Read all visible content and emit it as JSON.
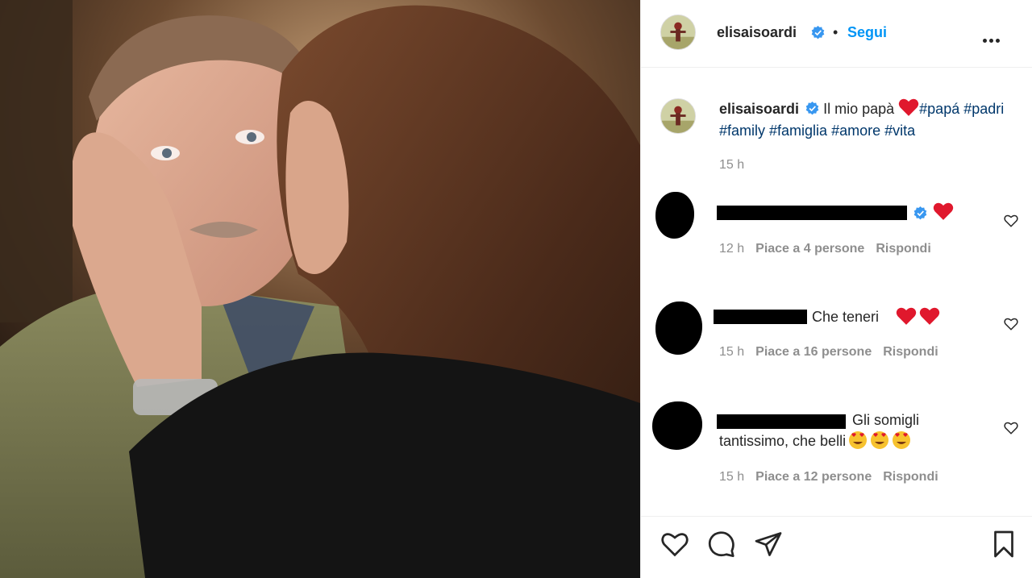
{
  "post": {
    "username": "elisaisoardi",
    "follow_label": "Segui",
    "separator": "•",
    "caption_text": "Il mio papà",
    "hashtags": [
      "#papá",
      "#padri",
      "#family",
      "#famiglia",
      "#amore",
      "#vita"
    ],
    "time": "15 h"
  },
  "comments": [
    {
      "text": "",
      "time": "12 h",
      "likes": "Piace a 4 persone",
      "reply": "Rispondi",
      "verified": true,
      "hearts": 1
    },
    {
      "text": "Che teneri",
      "time": "15 h",
      "likes": "Piace a 16 persone",
      "reply": "Rispondi",
      "hearts": 2
    },
    {
      "text_line1": "Gli somigli",
      "text_line2": "tantissimo, che belli",
      "time": "15 h",
      "likes": "Piace a 12 persone",
      "reply": "Rispondi",
      "faces": 3
    }
  ],
  "icons": {
    "like": "heart-outline-icon",
    "comment": "comment-bubble-icon",
    "share": "paper-plane-icon",
    "save": "bookmark-icon",
    "more": "more-options-icon",
    "verified": "verified-badge-icon"
  },
  "colors": {
    "accent": "#0095f6",
    "verified": "#3897f0",
    "text": "#262626",
    "muted": "#8e8e8e",
    "hashtag": "#00376b",
    "heart_red": "#e0182d"
  }
}
